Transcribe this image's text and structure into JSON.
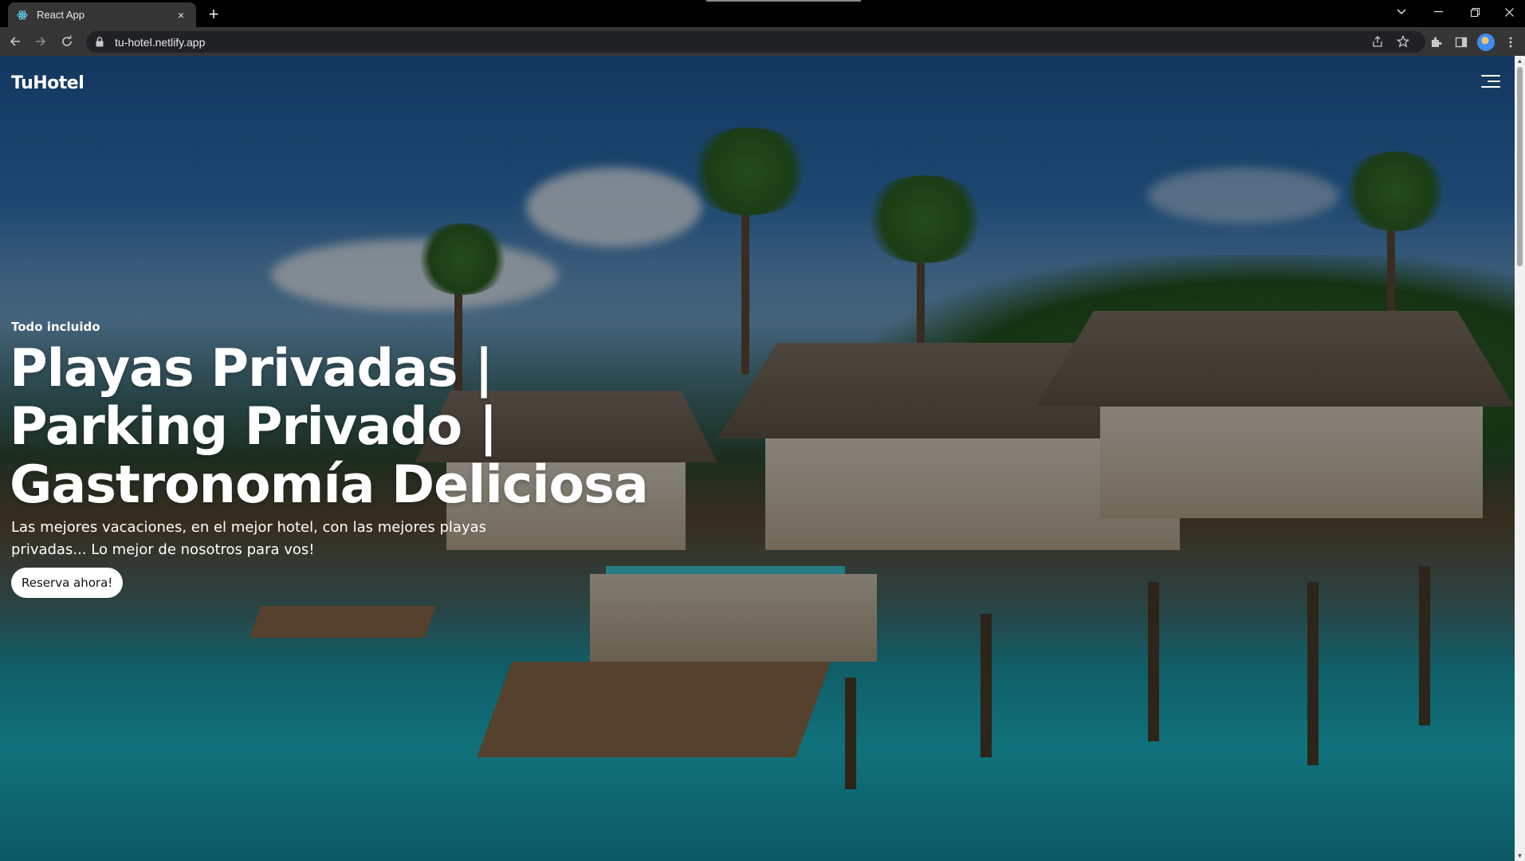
{
  "browser": {
    "tab_title": "React App",
    "tab_close": "×",
    "new_tab": "+",
    "url": "tu-hotel.netlify.app"
  },
  "site": {
    "brand": "TuHotel",
    "eyebrow": "Todo incluido",
    "headline": "Playas Privadas | Parking Privado | Gastronomía Deliciosa",
    "subtitle": "Las mejores vacaciones, en el mejor hotel, con las mejores playas privadas... Lo mejor de nosotros para vos!",
    "cta_label": "Reserva ahora!"
  },
  "icons": [
    "react-icon",
    "back-icon",
    "forward-icon",
    "reload-icon",
    "lock-icon",
    "share-icon",
    "star-icon",
    "extensions-icon",
    "sidepanel-icon",
    "profile-avatar",
    "more-icon",
    "hamburger-icon"
  ],
  "colors": {
    "accent": "#ffffff",
    "chrome_bg": "#353535",
    "tab_bar": "#000000"
  }
}
